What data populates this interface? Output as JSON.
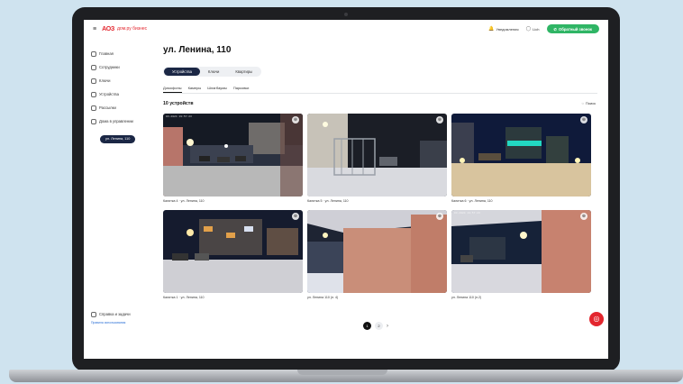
{
  "header": {
    "logo_mark": "АОЗ",
    "logo_text": "дом.ру бизнес",
    "notifications_label": "Уведомления",
    "user_label": "Lich",
    "call_label": "Обратный звонок"
  },
  "sidebar": {
    "items": [
      {
        "label": "Главная",
        "icon": "home-icon"
      },
      {
        "label": "Сотрудники",
        "icon": "users-icon"
      },
      {
        "label": "Ключи",
        "icon": "key-icon"
      },
      {
        "label": "Устройства",
        "icon": "device-icon"
      },
      {
        "label": "Рассылки",
        "icon": "mail-icon"
      },
      {
        "label": "Дома в управлении",
        "icon": "building-icon"
      }
    ],
    "selected_address": "ул. Ленина, 110",
    "support_label": "Справка и задачи",
    "terms_label": "Правила использования"
  },
  "main": {
    "title": "ул. Ленина, 110",
    "segments": [
      "Устройства",
      "Ключи",
      "Квартиры"
    ],
    "subtabs": [
      "Домофоны",
      "Камеры",
      "Шлагбаумы",
      "Парковки"
    ],
    "device_count": "10 устройств",
    "refresh_label": "Поиск"
  },
  "cameras": [
    {
      "label": "Калитка 4 · ул. Ленина, 110",
      "stamp": "03-2024 19:57:23"
    },
    {
      "label": "Калитка 5 · ул. Ленина, 110",
      "stamp": ""
    },
    {
      "label": "Калитка 6 · ул. Ленина, 110",
      "stamp": ""
    },
    {
      "label": "Калитка 1 · ул. Ленина, 110",
      "stamp": ""
    },
    {
      "label": "ул. Ленина 110 (п. 4)",
      "stamp": ""
    },
    {
      "label": "ул. Ленина 110 (п.2)",
      "stamp": "03-2024 19:57:23"
    }
  ],
  "pagination": {
    "pages": [
      "1",
      "2"
    ],
    "current": "1"
  }
}
